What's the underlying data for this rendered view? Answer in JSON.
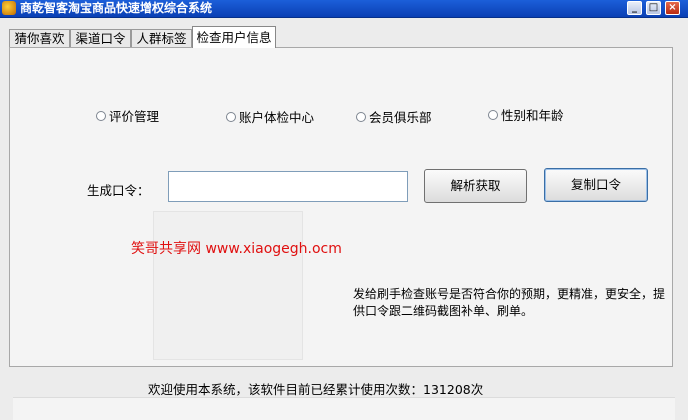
{
  "window": {
    "title": "商乾智客淘宝商品快速增权综合系统",
    "controls": {
      "minimize": "_",
      "maximize": "□",
      "close": "×"
    }
  },
  "tabs": [
    {
      "label": "猜你喜欢"
    },
    {
      "label": "渠道口令"
    },
    {
      "label": "人群标签"
    },
    {
      "label": "检查用户信息",
      "active": true
    }
  ],
  "radios": [
    {
      "label": "评价管理",
      "checked": false
    },
    {
      "label": "账户体检中心",
      "checked": false
    },
    {
      "label": "会员俱乐部",
      "checked": false
    },
    {
      "label": "性别和年龄",
      "checked": false
    }
  ],
  "form": {
    "code_label": "生成口令：",
    "code_value": "",
    "parse_button": "解析获取",
    "copy_button": "复制口令"
  },
  "watermark": "笑哥共享网 www.xiaogegh.ocm",
  "description": "发给刷手检查账号是否符合你的预期，更精准，更安全，提供口令跟二维码截图补单、刷单。",
  "status": "欢迎使用本系统，该软件目前已经累计使用次数：131208次"
}
